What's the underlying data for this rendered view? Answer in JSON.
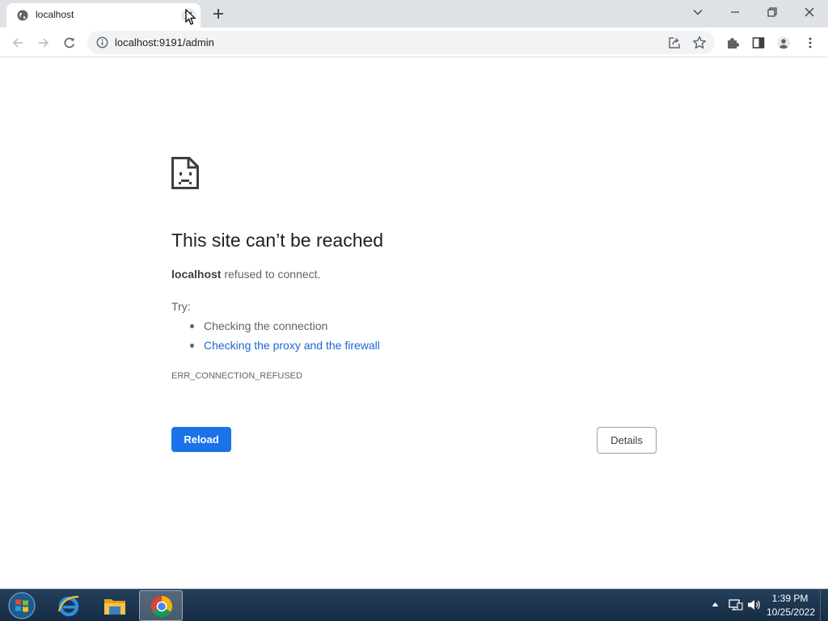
{
  "browser": {
    "tab": {
      "title": "localhost",
      "favicon": "globe-icon"
    },
    "address_bar": {
      "url": "localhost:9191/admin"
    }
  },
  "error_page": {
    "icon": "sad-document-icon",
    "title": "This site can’t be reached",
    "host": "localhost",
    "message": "refused to connect.",
    "try_label": "Try:",
    "suggestions": [
      {
        "text": "Checking the connection",
        "is_link": false
      },
      {
        "text": "Checking the proxy and the firewall",
        "is_link": true
      }
    ],
    "error_code": "ERR_CONNECTION_REFUSED",
    "reload_label": "Reload",
    "details_label": "Details"
  },
  "taskbar": {
    "items": [
      "start-orb-icon",
      "internet-explorer-icon",
      "file-explorer-icon",
      "chrome-icon"
    ],
    "active_item": "chrome-icon",
    "clock": {
      "time": "1:39 PM",
      "date": "10/25/2022"
    }
  },
  "colors": {
    "accent": "#1a73e8",
    "link": "#1967d2",
    "tabstrip": "#dee1e6"
  }
}
